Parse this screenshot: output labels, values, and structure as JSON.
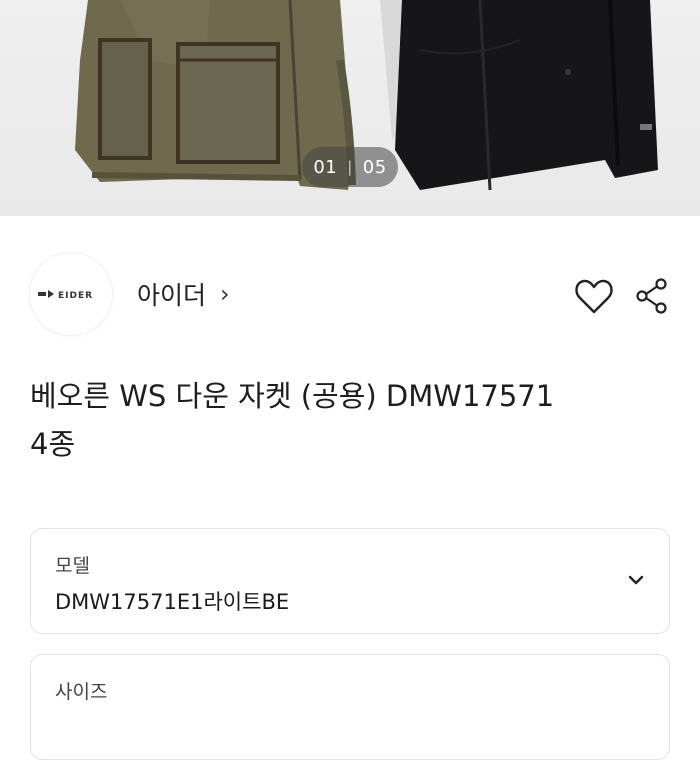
{
  "carousel": {
    "current": "01",
    "separator": "|",
    "total": "05"
  },
  "brand": {
    "logo_text": "EIDER",
    "name": "아이더",
    "chevron": "›"
  },
  "actions": {
    "like_icon": "heart-icon",
    "share_icon": "share-icon"
  },
  "product": {
    "title": "베오른 WS 다운 자켓 (공용) DMW17571 4종"
  },
  "options": [
    {
      "label": "모델",
      "value": "DMW17571E1라이트BE"
    },
    {
      "label": "사이즈",
      "value": ""
    }
  ],
  "colors": {
    "khaki_jacket": "#6f6a4e",
    "black_jacket": "#161618",
    "pager_bg": "#595959"
  }
}
